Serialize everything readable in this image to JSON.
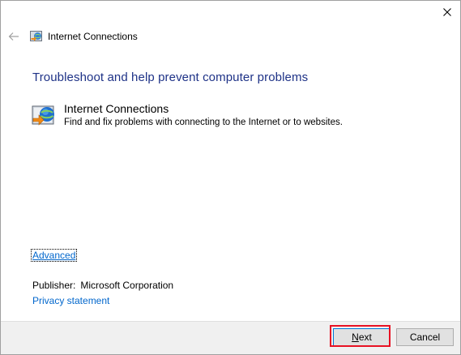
{
  "window": {
    "title": "Internet Connections"
  },
  "heading": "Troubleshoot and help prevent computer problems",
  "item": {
    "title": "Internet Connections",
    "description": "Find and fix problems with connecting to the Internet or to websites."
  },
  "links": {
    "advanced": "Advanced",
    "privacy": "Privacy statement"
  },
  "publisher": {
    "label": "Publisher:",
    "value": "Microsoft Corporation"
  },
  "buttons": {
    "next_first": "N",
    "next_rest": "ext",
    "cancel": "Cancel"
  },
  "colors": {
    "heading": "#1e3287",
    "link": "#0066cc",
    "highlight": "#e81123",
    "footer": "#f0f0f0"
  },
  "icons": {
    "back": "back-arrow-icon",
    "close": "close-icon",
    "app": "internet-connections-icon"
  }
}
